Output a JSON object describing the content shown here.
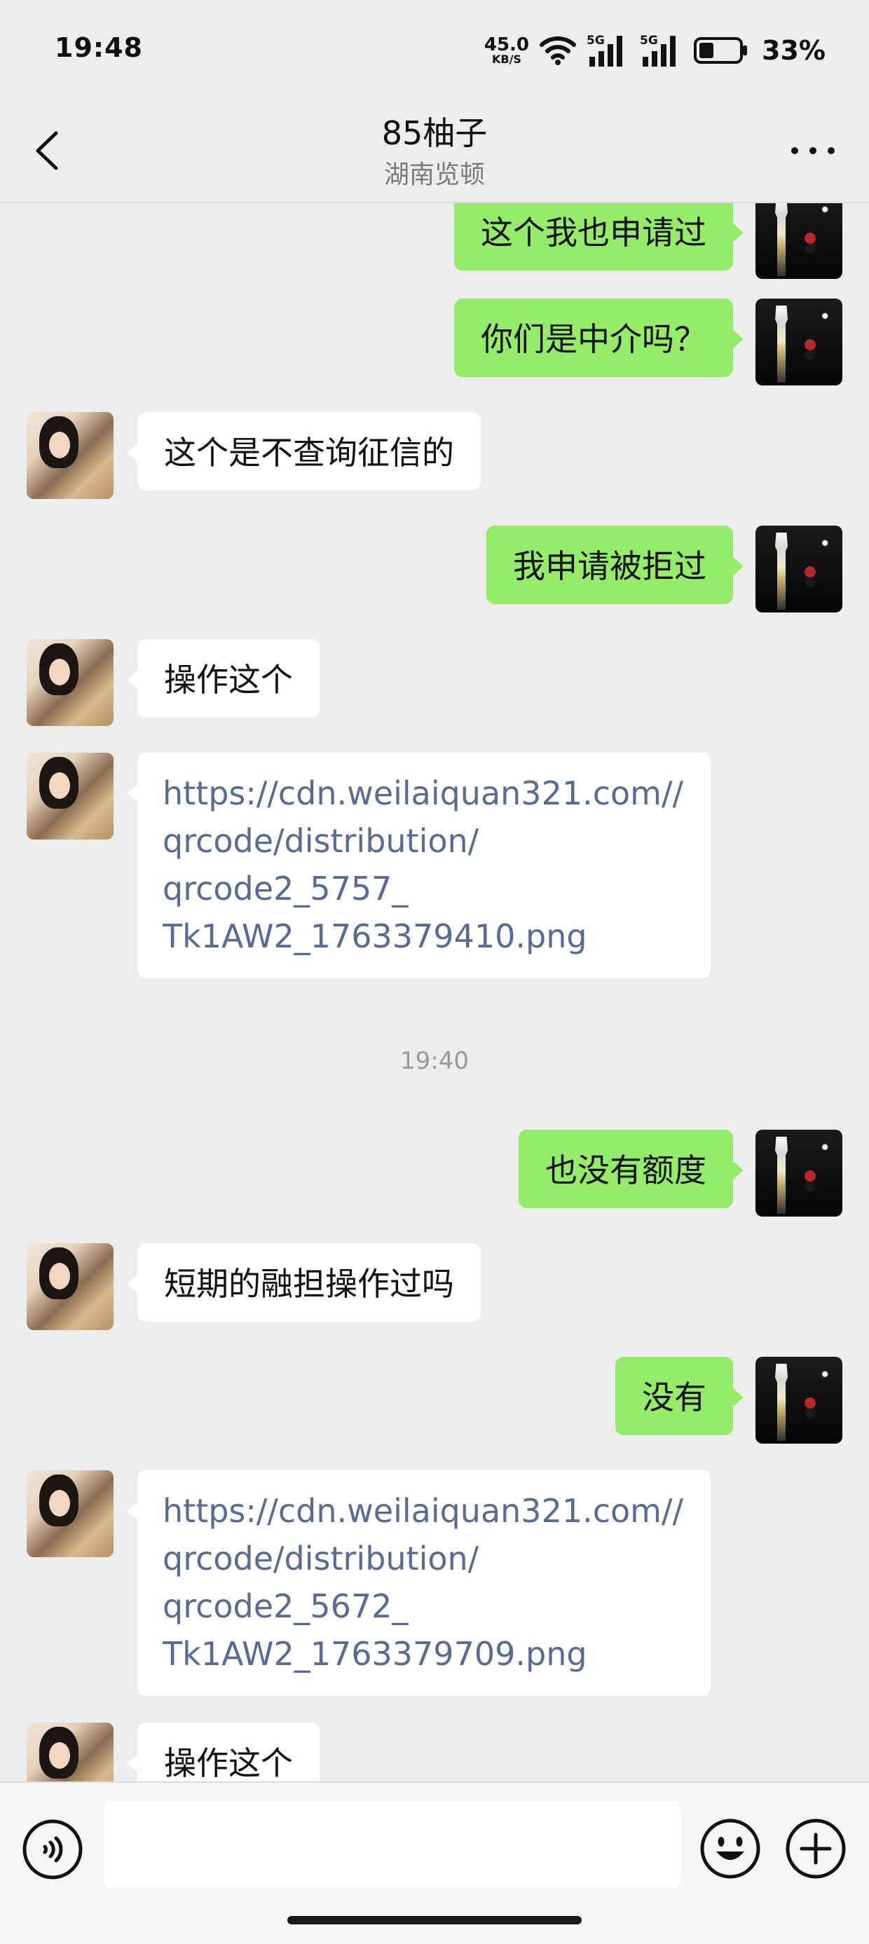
{
  "status_bar": {
    "time": "19:48",
    "net_speed_value": "45.0",
    "net_speed_unit": "KB/S",
    "signal1_label": "5G",
    "signal2_label": "5G",
    "battery_percent": "33%",
    "icons": [
      "wifi-icon",
      "signal-icon",
      "signal-icon",
      "battery-icon"
    ]
  },
  "header": {
    "title": "85柚子",
    "subtitle": "湖南览顿",
    "icons": [
      "back-arrow-icon",
      "more-dots-icon"
    ]
  },
  "messages": [
    {
      "side": "mine",
      "type": "text",
      "text": "这个我也申请过"
    },
    {
      "side": "mine",
      "type": "text",
      "text": "你们是中介吗？"
    },
    {
      "side": "theirs",
      "type": "text",
      "text": "这个是不查询征信的"
    },
    {
      "side": "mine",
      "type": "text",
      "text": "我申请被拒过"
    },
    {
      "side": "theirs",
      "type": "text",
      "text": "操作这个"
    },
    {
      "side": "theirs",
      "type": "link",
      "lines": [
        "https://cdn.weilaiquan321.com//",
        "qrcode/distribution/",
        "qrcode2_5757_",
        "Tk1AW2_1763379410.png"
      ]
    },
    {
      "type": "timestamp",
      "text": "19:40"
    },
    {
      "side": "mine",
      "type": "text",
      "text": "也没有额度"
    },
    {
      "side": "theirs",
      "type": "text",
      "text": "短期的融担操作过吗"
    },
    {
      "side": "mine",
      "type": "text",
      "text": "没有"
    },
    {
      "side": "theirs",
      "type": "link",
      "lines": [
        "https://cdn.weilaiquan321.com//",
        "qrcode/distribution/",
        "qrcode2_5672_",
        "Tk1AW2_1763379709.png"
      ]
    },
    {
      "side": "theirs",
      "type": "text",
      "text": "操作这个"
    }
  ],
  "input_bar": {
    "placeholder": "",
    "icons": [
      "voice-icon",
      "emoji-icon",
      "plus-icon"
    ]
  },
  "colors": {
    "mine_bubble": "#95ec69",
    "theirs_bubble": "#ffffff",
    "link": "#576b95",
    "background": "#ededed"
  }
}
